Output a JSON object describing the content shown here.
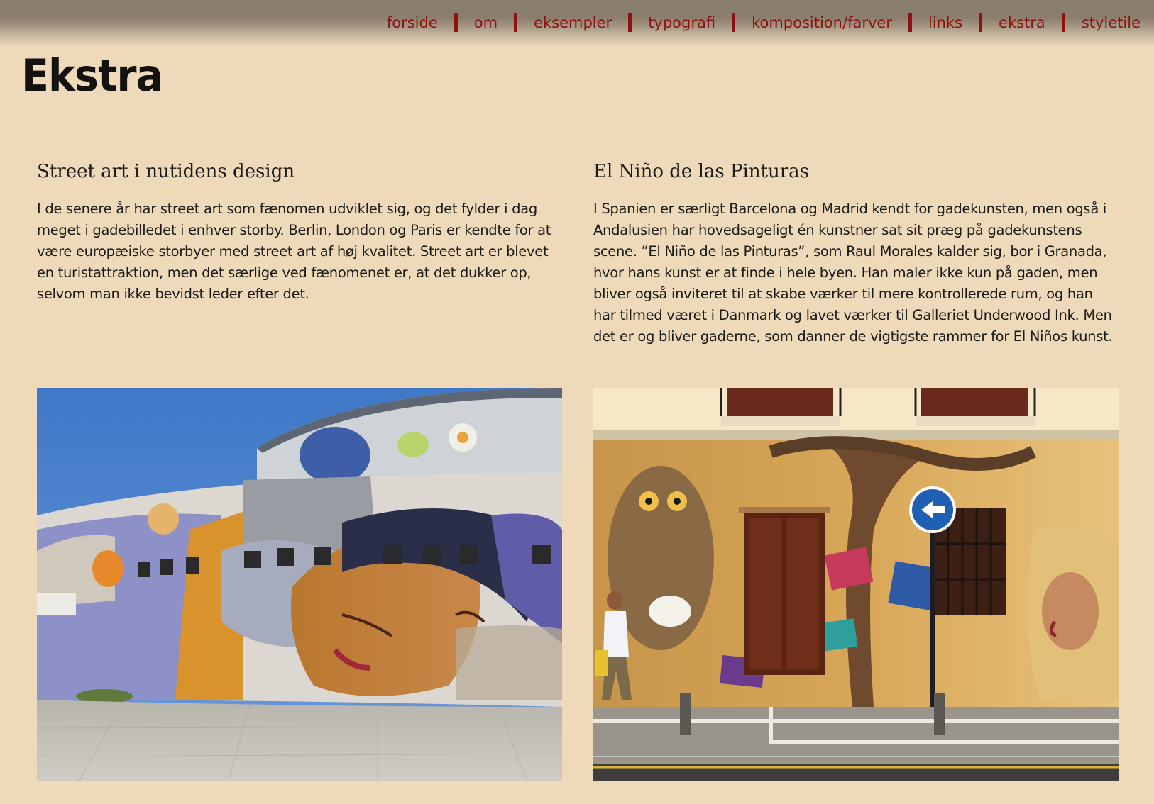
{
  "nav": {
    "items": [
      {
        "label": "forside"
      },
      {
        "label": "om"
      },
      {
        "label": "eksempler"
      },
      {
        "label": "typografi"
      },
      {
        "label": "komposition/farver"
      },
      {
        "label": "links"
      },
      {
        "label": "ekstra"
      },
      {
        "label": "styletile"
      }
    ]
  },
  "page": {
    "title": "Ekstra"
  },
  "columns": [
    {
      "heading": "Street art i nutidens design",
      "text": "I de senere år har street art som fænomen udviklet sig, og det fylder i dag meget i gadebilledet i enhver storby. Berlin, London og Paris er kendte for at være europæiske storbyer med street art af høj kvalitet. Street art er blevet en turistattraktion, men det særlige ved fænomenet er, at det dukker op, selvom man ikke bevidst leder efter det."
    },
    {
      "heading": "El Niño de las Pinturas",
      "text": "I Spanien er særligt Barcelona og Madrid kendt for gadekunsten, men også i Andalusien har hovedsageligt én kunstner sat sit præg på gadekunstens scene. ”El Niño de las Pinturas”, som Raul Morales kalder sig, bor i Granada, hvor hans kunst er at finde i hele byen. Han maler ikke kun på gaden, men bliver også inviteret til at skabe værker til mere kontrollerede rum, og han har tilmed været i Danmark og lavet værker til Galleriet Underwood Ink. Men det er og bliver gaderne, som danner de vigtigste rammer for El Niños kunst."
    }
  ],
  "colors": {
    "background": "#eed9bb",
    "nav_text": "#8e1116",
    "topbar": "#8a7d6c",
    "body_text": "#1c1a17"
  }
}
